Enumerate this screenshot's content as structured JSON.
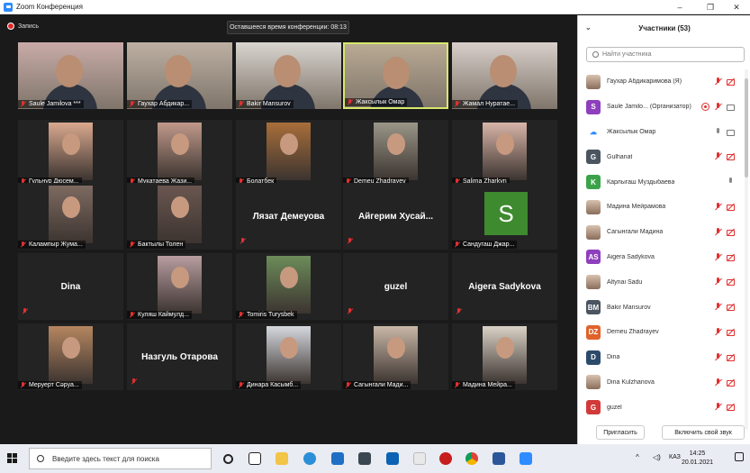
{
  "window": {
    "title": "Zoom Конференция",
    "controls": [
      "–",
      "❐",
      "✕"
    ]
  },
  "recording": {
    "label": "Запись"
  },
  "timer": {
    "text": "Оставшееся время конференции: 08:13"
  },
  "tiles": [
    {
      "name": "Saule Jamilova ***",
      "type": "video",
      "bg": "#c9aba8"
    },
    {
      "name": "Гаухар Абдикар...",
      "type": "video",
      "bg": "#bdb0a3"
    },
    {
      "name": "Bakir Mansurov",
      "type": "video",
      "bg": "#d8d4cf"
    },
    {
      "name": "Жаксылык Омар",
      "type": "video",
      "bg": "#b9aa94",
      "active": true
    },
    {
      "name": "Жамал Нуратае...",
      "type": "video",
      "bg": "#d8cfcb"
    },
    {
      "name": "Гульнур Дюсем...",
      "type": "photo",
      "bg": "#d9a98f"
    },
    {
      "name": "Мукатаева Жази...",
      "type": "photo",
      "bg": "#c0998a"
    },
    {
      "name": "Болатбек",
      "type": "photo",
      "bg": "#a86e3a"
    },
    {
      "name": "Demeu Zhadrayev",
      "type": "photo",
      "bg": "#9a9688"
    },
    {
      "name": "Salima Zharkyn",
      "type": "photo",
      "bg": "#d8b4a8"
    },
    {
      "name": "Калампыр Жума...",
      "type": "photo",
      "bg": "#7d6a60"
    },
    {
      "name": "Бактылы Толен",
      "type": "photo",
      "bg": "#6a5650"
    },
    {
      "name": "Лязат Демеуова",
      "type": "text"
    },
    {
      "name": "Айгерим  Хусай...",
      "type": "text"
    },
    {
      "name": "Сандугаш Джар...",
      "type": "avatar",
      "letter": "S"
    },
    {
      "name": "Dina",
      "type": "text"
    },
    {
      "name": "Куляш Каймулд...",
      "type": "photo",
      "bg": "#b89da0"
    },
    {
      "name": "Tomiris Turysbek",
      "type": "photo",
      "bg": "#6c8c5a"
    },
    {
      "name": "guzel",
      "type": "text"
    },
    {
      "name": "Aigera Sadykova",
      "type": "text"
    },
    {
      "name": "Меруерт Сәруа...",
      "type": "photo",
      "bg": "#b58660"
    },
    {
      "name": "Назгуль Отарова",
      "type": "text"
    },
    {
      "name": "Динара Касымб...",
      "type": "photo",
      "bg": "#d5d8de"
    },
    {
      "name": "Сагынгали Мади...",
      "type": "photo",
      "bg": "#c9b7a8"
    },
    {
      "name": "Мадина Мейра...",
      "type": "photo",
      "bg": "#d9d2c5"
    }
  ],
  "panel": {
    "title": "Участники (53)",
    "search_placeholder": "Найти участника",
    "participants": [
      {
        "name": "Гаухар Абдикаримова (Я)",
        "avatar": "photo",
        "icons": [
          "mr",
          "cr"
        ]
      },
      {
        "name": "Saule Jamilo... (Организатор)",
        "avatar": "letter",
        "letter": "S",
        "color": "#8e3fbd",
        "icons": [
          "rec",
          "mr",
          "cg"
        ]
      },
      {
        "name": "Жаксылык Омар",
        "avatar": "cloud",
        "icons": [
          "mg",
          "cg"
        ]
      },
      {
        "name": "Gulhanat",
        "avatar": "letter",
        "letter": "G",
        "color": "#4a5560",
        "icons": [
          "mr",
          "cr"
        ]
      },
      {
        "name": "Карлыгаш Муздыбаева",
        "avatar": "letter",
        "letter": "K",
        "color": "#3aa34a",
        "icons": [
          "mg"
        ]
      },
      {
        "name": "Мадина Мейрамова",
        "avatar": "photo",
        "icons": [
          "mr",
          "cr"
        ]
      },
      {
        "name": "Сагынгали Мадина",
        "avatar": "photo",
        "icons": [
          "mr",
          "cr"
        ]
      },
      {
        "name": "Aigera Sadykova",
        "avatar": "letter",
        "letter": "AS",
        "color": "#8e3fbd",
        "icons": [
          "mr",
          "cr"
        ]
      },
      {
        "name": "Altynai Sadu",
        "avatar": "photo",
        "icons": [
          "mr",
          "cr"
        ]
      },
      {
        "name": "Bakir Mansurov",
        "avatar": "letter",
        "letter": "BM",
        "color": "#4a5560",
        "icons": [
          "mr",
          "cr"
        ]
      },
      {
        "name": "Demeu Zhadrayev",
        "avatar": "letter",
        "letter": "DZ",
        "color": "#e0622a",
        "icons": [
          "mr",
          "cr"
        ]
      },
      {
        "name": "Dina",
        "avatar": "letter",
        "letter": "D",
        "color": "#2c4a6a",
        "icons": [
          "mr",
          "cr"
        ]
      },
      {
        "name": "Dina Kulzhanova",
        "avatar": "photo",
        "icons": [
          "mr",
          "cr"
        ]
      },
      {
        "name": "guzel",
        "avatar": "letter",
        "letter": "G",
        "color": "#d23a3a",
        "icons": [
          "mr",
          "cr"
        ]
      }
    ],
    "invite_label": "Пригласить",
    "unmute_label": "Включить свой звук"
  },
  "taskbar": {
    "search_placeholder": "Введите здесь текст для поиска",
    "lang": "КАЗ",
    "time": "14:25",
    "date": "20.01.2021"
  }
}
